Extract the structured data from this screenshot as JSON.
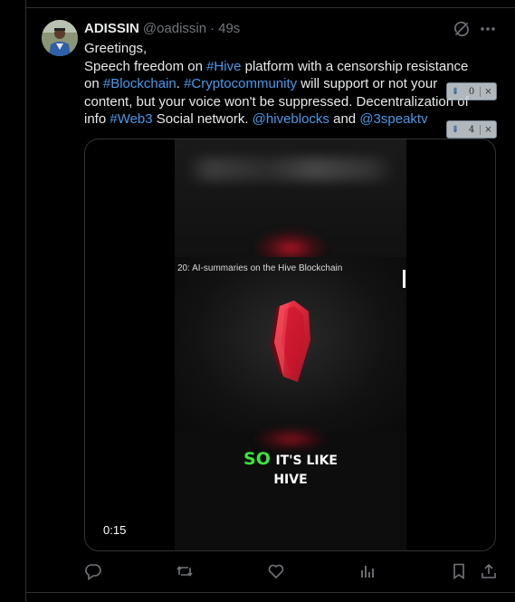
{
  "post": {
    "display_name": "ADISSIN",
    "handle": "@oadissin",
    "separator": "·",
    "timestamp": "49s",
    "text_lines": [
      [
        {
          "t": "Greetings,",
          "link": false
        }
      ],
      [
        {
          "t": "Speech freedom on ",
          "link": false
        },
        {
          "t": "#Hive",
          "link": true
        },
        {
          "t": " platform with a censorship resistance",
          "link": false
        }
      ],
      [
        {
          "t": "on ",
          "link": false
        },
        {
          "t": "#Blockchain",
          "link": true
        },
        {
          "t": ". ",
          "link": false
        },
        {
          "t": "#Cryptocommunity",
          "link": true
        },
        {
          "t": " will support or not your",
          "link": false
        }
      ],
      [
        {
          "t": "content, but your voice won't be suppressed. Decentralization of",
          "link": false
        }
      ],
      [
        {
          "t": "info ",
          "link": false
        },
        {
          "t": "#Web3",
          "link": true
        },
        {
          "t": " Social network. ",
          "link": false
        },
        {
          "t": "@hiveblocks",
          "link": true
        },
        {
          "t": " and ",
          "link": false
        },
        {
          "t": "@3speaktv",
          "link": true
        }
      ]
    ]
  },
  "overlay_widgets": [
    {
      "count": "0",
      "arrow": "⇓",
      "close": "×"
    },
    {
      "count": "4",
      "arrow": "⇓",
      "close": "×"
    }
  ],
  "media": {
    "inner_title": "20: AI-summaries on the Hive Blockchain",
    "caption_highlight": "SO",
    "caption_line1_rest": "IT'S LIKE",
    "caption_line2": "HIVE",
    "duration": "0:15"
  },
  "icons": {
    "grok": "grok-icon",
    "more": "more-icon",
    "reply": "reply-icon",
    "repost": "repost-icon",
    "like": "like-icon",
    "views": "views-icon",
    "bookmark": "bookmark-icon",
    "share": "share-icon"
  },
  "colors": {
    "link": "#4a99e9",
    "muted": "#71767b",
    "caption_highlight": "#3ee23e",
    "hive_red": "#e31337"
  }
}
